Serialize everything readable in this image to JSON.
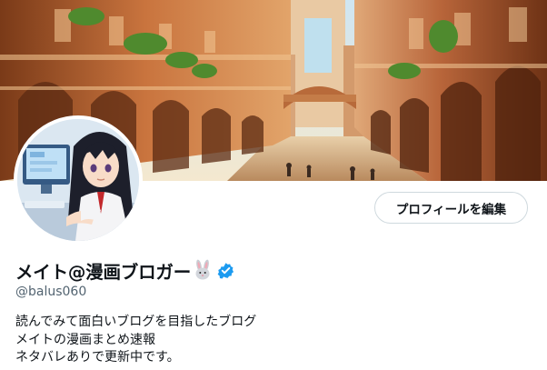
{
  "profile": {
    "display_name": "メイト@漫画ブロガー",
    "name_emoji_icon": "rabbit-face-icon",
    "verified_badge_icon": "verified-check-icon",
    "handle": "@balus060",
    "edit_button_label": "プロフィールを編集",
    "bio_lines": [
      "読んでみて面白いブログを目指したブログ",
      "メイトの漫画まとめ速報",
      "ネタバレありで更新中です。"
    ]
  },
  "colors": {
    "verified_blue": "#1d9bf0",
    "text_primary": "#0f1419",
    "text_secondary": "#536471",
    "button_border": "#cfd9de"
  }
}
